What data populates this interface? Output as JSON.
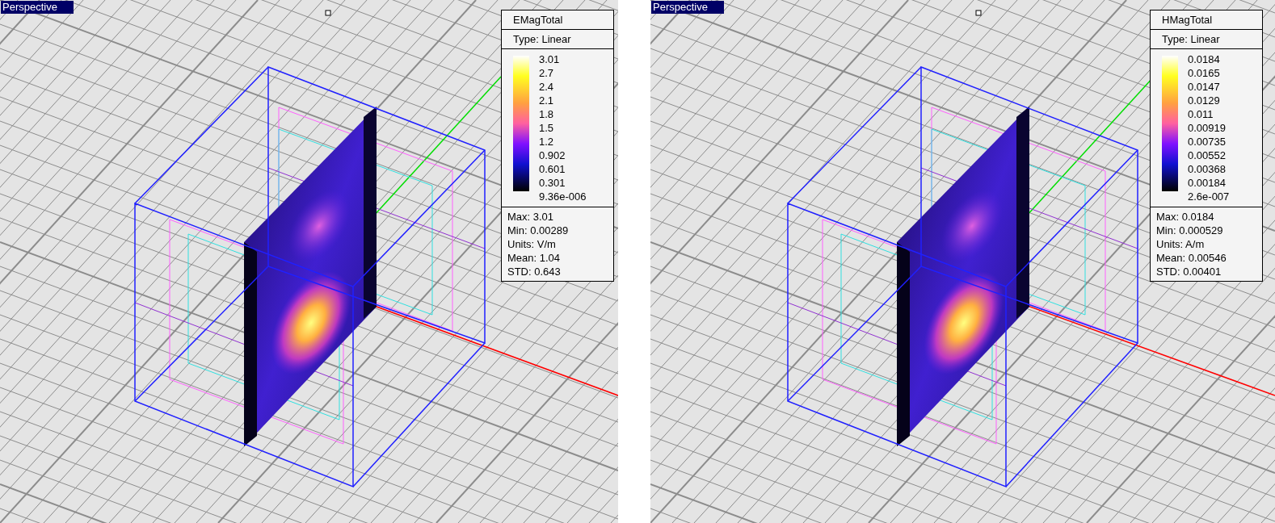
{
  "viewports": [
    {
      "label": "Perspective",
      "legend": {
        "title": "EMagTotal",
        "type": "Type: Linear",
        "ticks": [
          "3.01",
          "2.7",
          "2.4",
          "2.1",
          "1.8",
          "1.5",
          "1.2",
          "0.902",
          "0.601",
          "0.301",
          "9.36e-006"
        ],
        "stats": [
          "Max: 3.01",
          "Min: 0.00289",
          "Units: V/m",
          "Mean: 1.04",
          "STD: 0.643"
        ]
      }
    },
    {
      "label": "Perspective",
      "legend": {
        "title": "HMagTotal",
        "type": "Type: Linear",
        "ticks": [
          "0.0184",
          "0.0165",
          "0.0147",
          "0.0129",
          "0.011",
          "0.00919",
          "0.00735",
          "0.00552",
          "0.00368",
          "0.00184",
          "2.6e-007"
        ],
        "stats": [
          "Max: 0.0184",
          "Min: 0.000529",
          "Units: A/m",
          "Mean: 0.00546",
          "STD: 0.00401"
        ]
      }
    }
  ]
}
